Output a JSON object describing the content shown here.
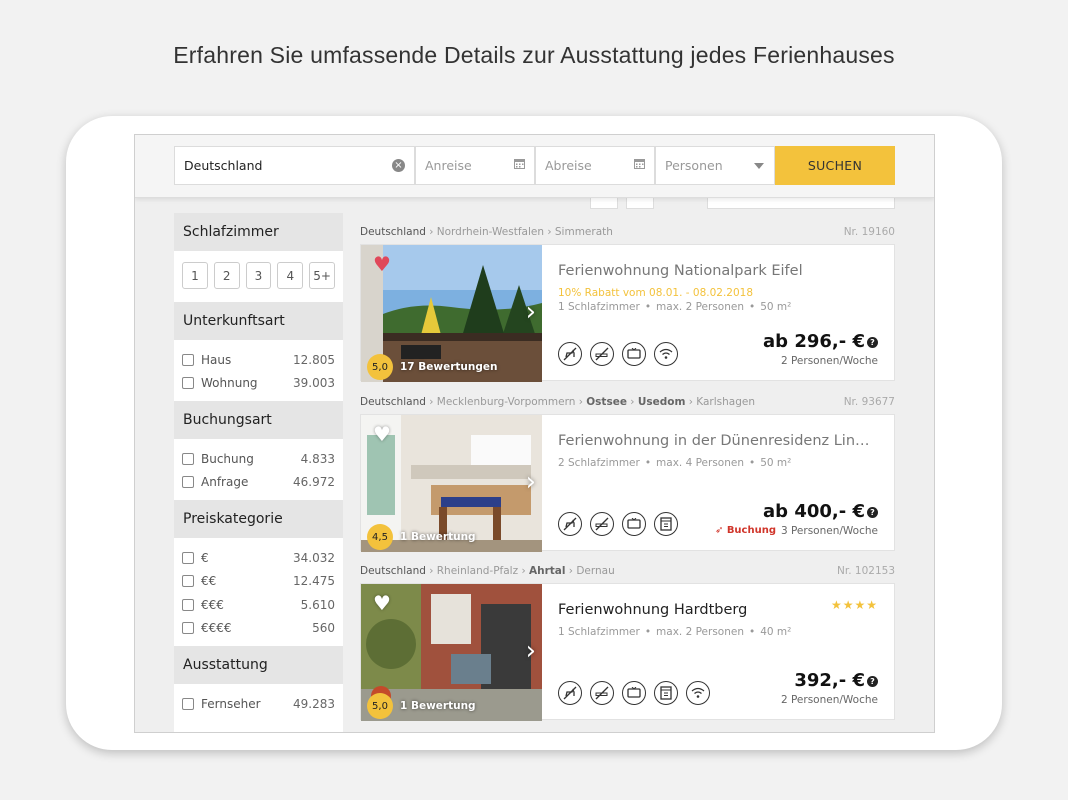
{
  "headline": "Erfahren Sie umfassende Details zur Ausstattung jedes Ferienhauses",
  "search": {
    "destination": "Deutschland",
    "arrival_placeholder": "Anreise",
    "departure_placeholder": "Abreise",
    "persons_placeholder": "Personen",
    "button": "SUCHEN"
  },
  "filters": {
    "bedrooms": {
      "title": "Schlafzimmer",
      "options": [
        "1",
        "2",
        "3",
        "4",
        "5+"
      ]
    },
    "type": {
      "title": "Unterkunftsart",
      "items": [
        {
          "label": "Haus",
          "count": "12.805"
        },
        {
          "label": "Wohnung",
          "count": "39.003"
        }
      ]
    },
    "booking": {
      "title": "Buchungsart",
      "items": [
        {
          "label": "Buchung",
          "count": "4.833"
        },
        {
          "label": "Anfrage",
          "count": "46.972"
        }
      ]
    },
    "price": {
      "title": "Preiskategorie",
      "items": [
        {
          "label": "€",
          "count": "34.032"
        },
        {
          "label": "€€",
          "count": "12.475"
        },
        {
          "label": "€€€",
          "count": "5.610"
        },
        {
          "label": "€€€€",
          "count": "560"
        }
      ]
    },
    "amenities": {
      "title": "Ausstattung",
      "items": [
        {
          "label": "Fernseher",
          "count": "49.283"
        }
      ]
    }
  },
  "listings": [
    {
      "crumbs": [
        "Deutschland",
        "Nordrhein-Westfalen",
        "Simmerath"
      ],
      "nr": "Nr. 19160",
      "title": "Ferienwohnung Nationalpark Eifel",
      "promo": "10% Rabatt vom 08.01. - 08.02.2018",
      "bedrooms": "1 Schlafzimmer",
      "persons": "max. 2 Personen",
      "size": "50 m²",
      "price": "ab 296,- €",
      "price_note": "2 Personen/Woche",
      "rating": "5,0",
      "reviews": "17 Bewertungen",
      "favorited": true
    },
    {
      "crumbs": [
        "Deutschland",
        "Mecklenburg-Vorpommern",
        "Ostsee",
        "Usedom",
        "Karlshagen"
      ],
      "nr": "Nr. 93677",
      "title": "Ferienwohnung in der Dünenresidenz Lindenstraße",
      "bedrooms": "2 Schlafzimmer",
      "persons": "max. 4 Personen",
      "size": "50 m²",
      "price": "ab 400,- €",
      "price_note": "3 Personen/Woche",
      "booking_label": "Buchung",
      "rating": "4,5",
      "reviews": "1 Bewertung",
      "favorited": false
    },
    {
      "crumbs": [
        "Deutschland",
        "Rheinland-Pfalz",
        "Ahrtal",
        "Dernau"
      ],
      "nr": "Nr. 102153",
      "title": "Ferienwohnung Hardtberg",
      "stars": "★★★★",
      "bedrooms": "1 Schlafzimmer",
      "persons": "max. 2 Personen",
      "size": "40 m²",
      "price": "392,- €",
      "price_note": "2 Personen/Woche",
      "rating": "5,0",
      "reviews": "1 Bewertung",
      "favorited": false
    }
  ],
  "colors": {
    "accent": "#f3c23c",
    "favorite": "#e0485a",
    "booking": "#d0352a"
  }
}
